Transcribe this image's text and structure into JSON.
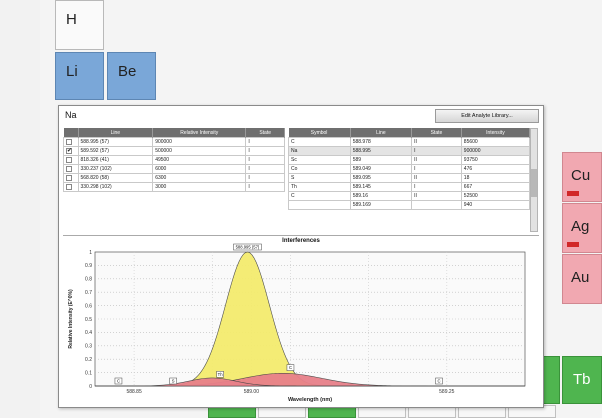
{
  "periodic_table": {
    "elements": [
      {
        "symbol": "H"
      },
      {
        "symbol": "Li"
      },
      {
        "symbol": "Be"
      },
      {
        "symbol": "Cu"
      },
      {
        "symbol": "Ag"
      },
      {
        "symbol": "Au"
      },
      {
        "symbol": "Tb"
      }
    ]
  },
  "dialog": {
    "element": "Na",
    "edit_button": "Edit Analyte Library...",
    "lines_table": {
      "headers": [
        "Line",
        "Relative Intensity",
        "State"
      ],
      "rows": [
        {
          "checked": false,
          "line": "588.995 (57)",
          "intensity": "900000",
          "state": "I"
        },
        {
          "checked": true,
          "line": "589.592 (57)",
          "intensity": "500000",
          "state": "I"
        },
        {
          "checked": false,
          "line": "818.326 (41)",
          "intensity": "49500",
          "state": "I"
        },
        {
          "checked": false,
          "line": "330.237 (102)",
          "intensity": "6000",
          "state": "I"
        },
        {
          "checked": false,
          "line": "568.820 (58)",
          "intensity": "6300",
          "state": "I"
        },
        {
          "checked": false,
          "line": "330.298 (102)",
          "intensity": "3000",
          "state": "I"
        }
      ]
    },
    "interference_table": {
      "headers": [
        "Symbol",
        "Line",
        "State",
        "Intensity"
      ],
      "rows": [
        {
          "symbol": "C",
          "line": "588.978",
          "state": "II",
          "intensity": "85600"
        },
        {
          "symbol": "Na",
          "line": "588.995",
          "state": "I",
          "intensity": "900000"
        },
        {
          "symbol": "Sc",
          "line": "589",
          "state": "II",
          "intensity": "93750"
        },
        {
          "symbol": "Co",
          "line": "589.049",
          "state": "I",
          "intensity": "476"
        },
        {
          "symbol": "S",
          "line": "589.095",
          "state": "II",
          "intensity": "18"
        },
        {
          "symbol": "Th",
          "line": "589.145",
          "state": "I",
          "intensity": "667"
        },
        {
          "symbol": "C",
          "line": "589.16",
          "state": "II",
          "intensity": "52500"
        },
        {
          "symbol": "",
          "line": "589.169",
          "state": "",
          "intensity": "940"
        }
      ]
    }
  },
  "chart_data": {
    "type": "area",
    "title": "Interferences",
    "xlabel": "Wavelength (nm)",
    "ylabel": "Relative Intensity (E^0%)",
    "xlim": [
      588.8,
      589.35
    ],
    "ylim": [
      0,
      1
    ],
    "x_ticks": [
      "588.85",
      "589.00",
      "589.25"
    ],
    "y_ticks": [
      "0",
      "0.1",
      "0.2",
      "0.3",
      "0.4",
      "0.5",
      "0.6",
      "0.7",
      "0.8",
      "0.9",
      "1"
    ],
    "grid": true,
    "series": [
      {
        "name": "Na",
        "color": "#f4ec6e",
        "center": 588.995,
        "peak": 1.0,
        "width": 0.028
      },
      {
        "name": "C",
        "color": "#e8808a",
        "center": 589.04,
        "peak": 0.095,
        "width": 0.05
      },
      {
        "name": "C",
        "color": "#e8808a",
        "center": 588.95,
        "peak": 0.06,
        "width": 0.03
      }
    ],
    "markers": [
      {
        "label": "588.995 (57)",
        "x": 588.995,
        "y": 1.0
      },
      {
        "label": "C",
        "x": 588.83,
        "y": 0.0
      },
      {
        "label": "S",
        "x": 588.9,
        "y": 0.0
      },
      {
        "label": "Th",
        "x": 588.96,
        "y": 0.05
      },
      {
        "label": "C",
        "x": 589.05,
        "y": 0.1
      },
      {
        "label": "C",
        "x": 589.24,
        "y": 0.0
      }
    ]
  }
}
